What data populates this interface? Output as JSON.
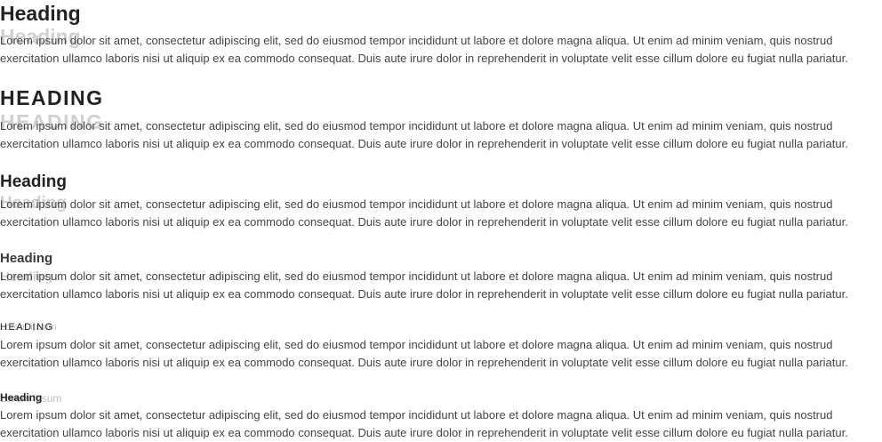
{
  "sections": [
    {
      "heading": "Heading",
      "overlay": "Heading",
      "paragraph": "Lorem ipsum dolor sit amet, consectetur adipiscing elit, sed do eiusmod tempor incididunt ut labore et dolore magna aliqua. Ut enim ad minim veniam, quis nostrud exercitation ullamco laboris nisi ut aliquip ex ea commodo consequat. Duis aute irure dolor in reprehenderit in voluptate velit esse cillum dolore eu fugiat nulla pariatur."
    },
    {
      "heading": "HEADING",
      "overlay": "HEADING",
      "paragraph": "Lorem ipsum dolor sit amet, consectetur adipiscing elit, sed do eiusmod tempor incididunt ut labore et dolore magna aliqua. Ut enim ad minim veniam, quis nostrud exercitation ullamco laboris nisi ut aliquip ex ea commodo consequat. Duis aute irure dolor in reprehenderit in voluptate velit esse cillum dolore eu fugiat nulla pariatur."
    },
    {
      "heading": "Heading",
      "overlay": "Heading",
      "paragraph": "Lorem ipsum dolor sit amet, consectetur adipiscing elit, sed do eiusmod tempor incididunt ut labore et dolore magna aliqua. Ut enim ad minim veniam, quis nostrud exercitation ullamco laboris nisi ut aliquip ex ea commodo consequat. Duis aute irure dolor in reprehenderit in voluptate velit esse cillum dolore eu fugiat nulla pariatur."
    },
    {
      "heading": "Heading",
      "overlay": "Heading",
      "paragraph": "Lorem ipsum dolor sit amet, consectetur adipiscing elit, sed do eiusmod tempor incididunt ut labore et dolore magna aliqua. Ut enim ad minim veniam, quis nostrud exercitation ullamco laboris nisi ut aliquip ex ea commodo consequat. Duis aute irure dolor in reprehenderit in voluptate velit esse cillum dolore eu fugiat nulla pariatur."
    },
    {
      "heading": "HEADING",
      "overlay": "Lorem ipsum",
      "paragraph": "Lorem ipsum dolor sit amet, consectetur adipiscing elit, sed do eiusmod tempor incididunt ut labore et dolore magna aliqua. Ut enim ad minim veniam, quis nostrud exercitation ullamco laboris nisi ut aliquip ex ea commodo consequat. Duis aute irure dolor in reprehenderit in voluptate velit esse cillum dolore eu fugiat nulla pariatur."
    },
    {
      "heading": "Heading",
      "overlay": "Lorem ipsum",
      "paragraph": "Lorem ipsum dolor sit amet, consectetur adipiscing elit, sed do eiusmod tempor incididunt ut labore et dolore magna aliqua. Ut enim ad minim veniam, quis nostrud exercitation ullamco laboris nisi ut aliquip ex ea commodo consequat. Duis aute irure dolor in reprehenderit in voluptate velit esse cillum dolore eu fugiat nulla pariatur."
    }
  ],
  "colors": {
    "heading": "#222222",
    "overlay": "#c6c6c6",
    "paragraph": "#444444",
    "background": "#ffffff"
  }
}
